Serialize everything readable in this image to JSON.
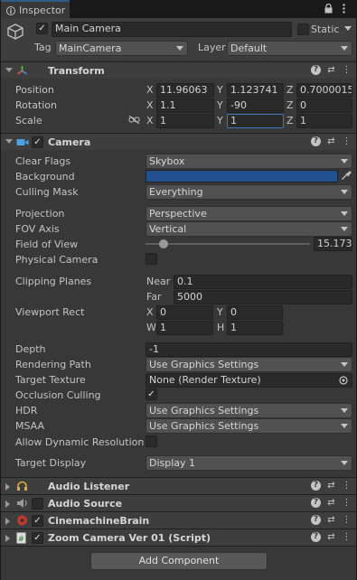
{
  "tab": {
    "label": "Inspector"
  },
  "object": {
    "name": "Main Camera",
    "static_label": "Static",
    "tag_label": "Tag",
    "tag_value": "MainCamera",
    "layer_label": "Layer",
    "layer_value": "Default"
  },
  "transform": {
    "title": "Transform",
    "position_label": "Position",
    "rotation_label": "Rotation",
    "scale_label": "Scale",
    "axis_x": "X",
    "axis_y": "Y",
    "axis_z": "Z",
    "position": {
      "x": "11.96063",
      "y": "1.123741",
      "z": "0.7000015"
    },
    "rotation": {
      "x": "1.1",
      "y": "-90",
      "z": "0"
    },
    "scale": {
      "x": "1",
      "y": "1",
      "z": "1"
    }
  },
  "camera": {
    "title": "Camera",
    "clear_flags_label": "Clear Flags",
    "clear_flags": "Skybox",
    "background_label": "Background",
    "background_color": "#23508f",
    "culling_mask_label": "Culling Mask",
    "culling_mask": "Everything",
    "projection_label": "Projection",
    "projection": "Perspective",
    "fov_axis_label": "FOV Axis",
    "fov_axis": "Vertical",
    "fov_label": "Field of View",
    "fov_value": "15.1734",
    "fov_fraction": 0.08,
    "physical_label": "Physical Camera",
    "clipping_label": "Clipping Planes",
    "near_label": "Near",
    "near": "0.1",
    "far_label": "Far",
    "far": "5000",
    "viewport_label": "Viewport Rect",
    "vp_x_label": "X",
    "vp_x": "0",
    "vp_y_label": "Y",
    "vp_y": "0",
    "vp_w_label": "W",
    "vp_w": "1",
    "vp_h_label": "H",
    "vp_h": "1",
    "depth_label": "Depth",
    "depth": "-1",
    "rendering_label": "Rendering Path",
    "rendering": "Use Graphics Settings",
    "target_tex_label": "Target Texture",
    "target_tex": "None (Render Texture)",
    "occlusion_label": "Occlusion Culling",
    "hdr_label": "HDR",
    "hdr": "Use Graphics Settings",
    "msaa_label": "MSAA",
    "msaa": "Use Graphics Settings",
    "dynres_label": "Allow Dynamic Resolution",
    "target_display_label": "Target Display",
    "target_display": "Display 1"
  },
  "components": [
    {
      "name": "Audio Listener"
    },
    {
      "name": "Audio Source"
    },
    {
      "name": "CinemachineBrain"
    },
    {
      "name": "Zoom Camera Ver 01 (Script)"
    }
  ],
  "add_component": "Add Component",
  "icons": {
    "tab": "info-icon",
    "lock": "lock-icon",
    "menu": "kebab-menu-icon",
    "help": "help-icon",
    "preset": "preset-icon"
  }
}
